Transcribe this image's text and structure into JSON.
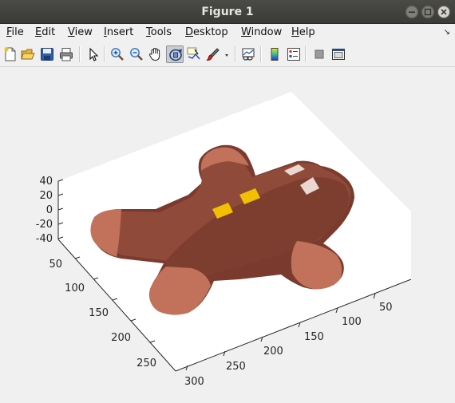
{
  "window": {
    "title": "Figure 1",
    "controls": [
      "minimize-icon",
      "maximize-icon",
      "close-icon"
    ]
  },
  "menubar": {
    "items": [
      {
        "label": "File",
        "mnemonic": "F"
      },
      {
        "label": "Edit",
        "mnemonic": "E"
      },
      {
        "label": "View",
        "mnemonic": "V"
      },
      {
        "label": "Insert",
        "mnemonic": "I"
      },
      {
        "label": "Tools",
        "mnemonic": "T"
      },
      {
        "label": "Desktop",
        "mnemonic": "D"
      },
      {
        "label": "Window",
        "mnemonic": "W"
      },
      {
        "label": "Help",
        "mnemonic": "H"
      }
    ],
    "dock_arrow": "↘"
  },
  "toolbar": {
    "buttons": [
      {
        "icon": "new-figure-icon"
      },
      {
        "icon": "open-file-icon"
      },
      {
        "icon": "save-icon"
      },
      {
        "icon": "print-icon"
      },
      {
        "icon": "edit-plot-pointer-icon"
      },
      {
        "icon": "zoom-in-icon"
      },
      {
        "icon": "zoom-out-icon"
      },
      {
        "icon": "pan-hand-icon"
      },
      {
        "icon": "rotate-3d-icon",
        "pressed": true
      },
      {
        "icon": "data-cursor-icon"
      },
      {
        "icon": "brush-icon"
      },
      {
        "icon": "brush-dropdown-icon"
      },
      {
        "icon": "link-plot-icon"
      },
      {
        "icon": "insert-colorbar-icon"
      },
      {
        "icon": "insert-legend-icon"
      },
      {
        "icon": "hide-plot-tools-icon"
      },
      {
        "icon": "show-plot-tools-icon"
      }
    ]
  },
  "plot": {
    "z_ticks": [
      "40",
      "20",
      "0",
      "-20",
      "-40"
    ],
    "y_ticks": [
      "50",
      "100",
      "150",
      "200",
      "250"
    ],
    "x_ticks": [
      "50",
      "100",
      "150",
      "200",
      "250",
      "300"
    ],
    "colors": {
      "body": "#8a4536",
      "body_dark": "#7a3b2e",
      "limb_end": "#c0705a",
      "buttons": "#f2c000",
      "eyes": "#e8d8d0"
    },
    "description_label": "3-D surface of gingerbread-man shape"
  }
}
